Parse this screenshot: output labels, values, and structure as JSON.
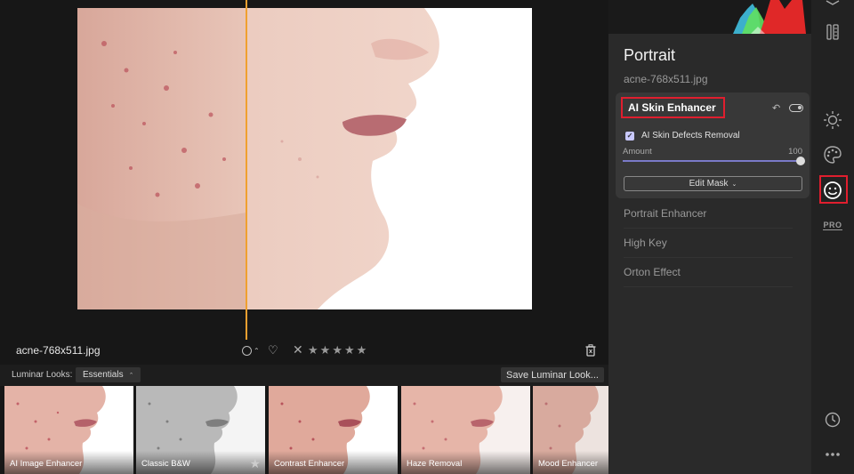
{
  "canvas": {
    "filename": "acne-768x511.jpg",
    "rating_stars": 5
  },
  "looks": {
    "label": "Luminar Looks:",
    "selected_collection": "Essentials",
    "save_button": "Save Luminar Look...",
    "thumbnails": [
      {
        "label": "AI Image Enhancer"
      },
      {
        "label": "Classic B&W"
      },
      {
        "label": "Contrast Enhancer"
      },
      {
        "label": "Haze Removal"
      },
      {
        "label": "Mood Enhancer"
      }
    ]
  },
  "panel": {
    "title": "Portrait",
    "subtitle": "acne-768x511.jpg",
    "active_tool": {
      "title": "AI Skin Enhancer",
      "checkbox_label": "AI Skin Defects Removal",
      "checkbox_checked": true,
      "amount_label": "Amount",
      "amount_value": "100",
      "edit_mask_label": "Edit Mask"
    },
    "tools": [
      {
        "label": "Portrait Enhancer"
      },
      {
        "label": "High Key"
      },
      {
        "label": "Orton Effect"
      }
    ]
  },
  "rail": {
    "pro_label": "PRO"
  },
  "colors": {
    "accent": "#f0a030",
    "highlight": "#e01e2e",
    "slider": "#7a7ac8"
  }
}
